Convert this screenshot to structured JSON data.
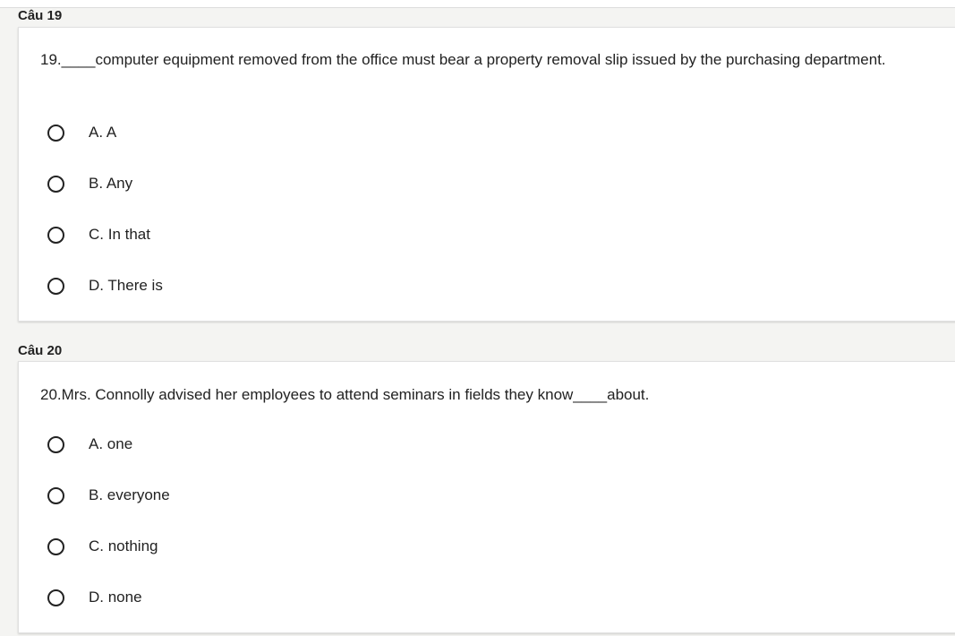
{
  "questions": [
    {
      "label": "Câu 19",
      "text": "19.____computer equipment removed from the office must bear a property removal slip issued by the purchasing department.",
      "options": [
        "A. A",
        "B. Any",
        "C. In that",
        "D. There is"
      ]
    },
    {
      "label": "Câu 20",
      "text": "20.Mrs. Connolly advised her employees to attend seminars in fields they know____about.",
      "options": [
        "A. one",
        "B. everyone",
        "C. nothing",
        "D. none"
      ]
    }
  ]
}
